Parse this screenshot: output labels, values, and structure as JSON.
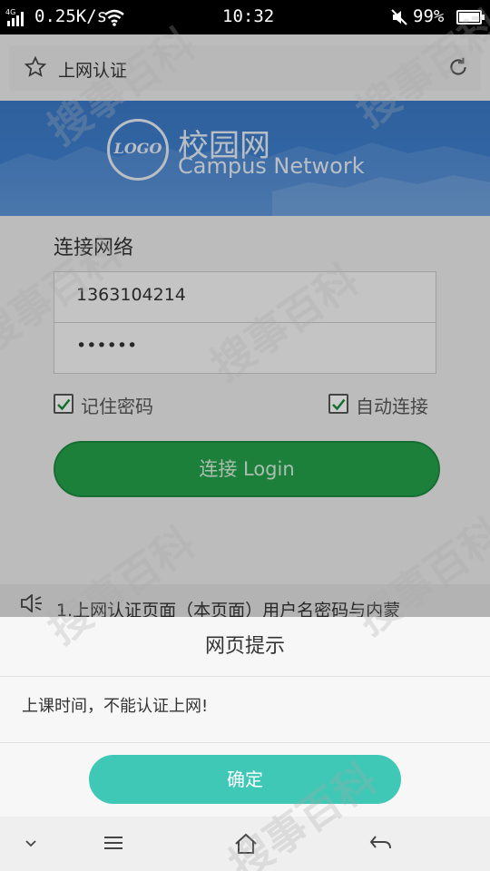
{
  "status_bar": {
    "network": "4G",
    "speed": "0.25K/s",
    "time": "10:32",
    "battery": "99%"
  },
  "browser": {
    "page_title": "上网认证"
  },
  "banner": {
    "logo_text": "LOGO",
    "name_cn": "校园网",
    "name_en": "Campus Network"
  },
  "login": {
    "heading": "连接网络",
    "username": "1363104214",
    "password_mask": "••••••",
    "remember_label": "记住密码",
    "auto_connect_label": "自动连接",
    "remember_checked": true,
    "auto_connect_checked": true,
    "button_label": "连接 Login"
  },
  "notice": {
    "text": "1.上网认证页面（本页面）用户名密码与内蒙"
  },
  "dialog": {
    "title": "网页提示",
    "message": "上课时间，不能认证上网!",
    "ok_label": "确定"
  },
  "watermark": {
    "text": "搜事百科"
  },
  "colors": {
    "banner_blue": "#3f7fcd",
    "login_green": "#23a04a",
    "ok_teal": "#3fc8b6"
  },
  "icons": [
    "signal-icon",
    "wifi-icon",
    "mute-icon",
    "battery-icon",
    "star-icon",
    "reload-icon",
    "speaker-icon",
    "chevron-down-icon",
    "menu-icon",
    "home-icon",
    "back-icon"
  ]
}
